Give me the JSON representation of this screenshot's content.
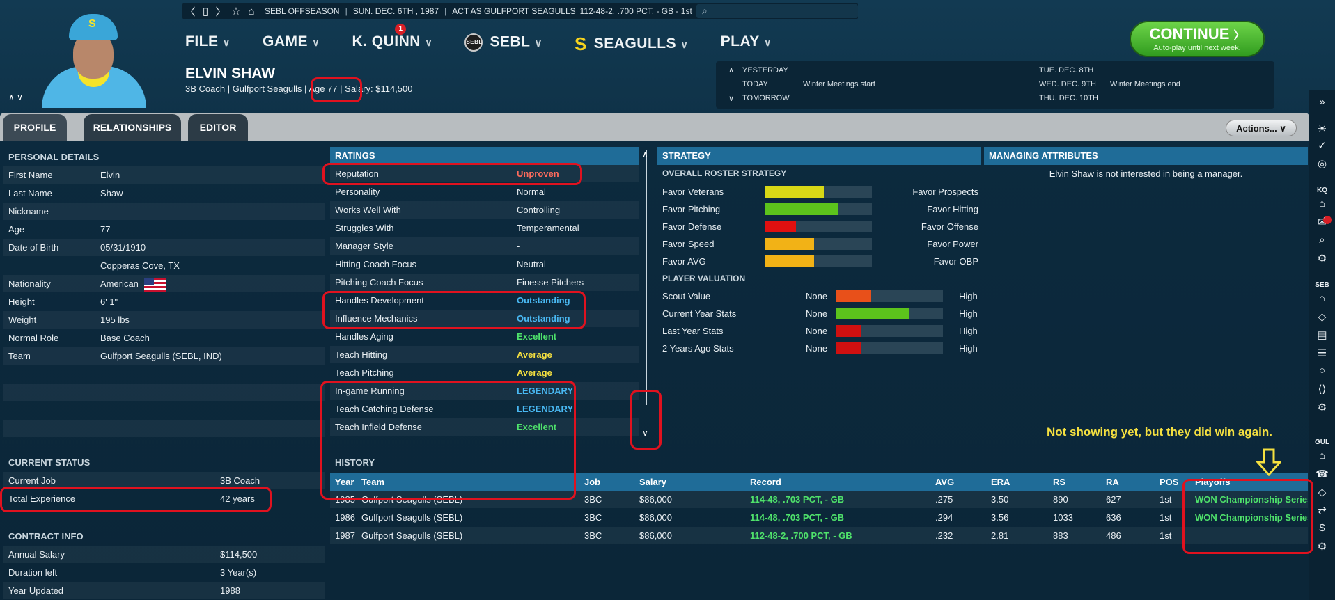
{
  "topbar": {
    "league_status": "SEBL OFFSEASON",
    "date": "SUN. DEC. 6TH , 1987",
    "act_as": "ACT AS GULFPORT SEAGULLS",
    "record": "112-48-2, .700 PCT, - GB - 1st"
  },
  "nav": {
    "items": [
      {
        "label": "FILE"
      },
      {
        "label": "GAME"
      },
      {
        "label": "K. QUINN",
        "badge": "1"
      },
      {
        "label": "SEBL",
        "logo_text": "SEBL"
      },
      {
        "label": "SEAGULLS",
        "logo_text": "S"
      },
      {
        "label": "PLAY"
      }
    ]
  },
  "continue": {
    "label": "CONTINUE",
    "sub": "Auto-play until next week.",
    "color": "#3fb02a"
  },
  "person": {
    "name": "ELVIN SHAW",
    "role": "3B Coach | Gulfport Seagulls",
    "age": "Age 77",
    "salary": "Salary: $114,500"
  },
  "schedule": {
    "yesterday": "YESTERDAY",
    "today": "TODAY",
    "tomorrow": "TOMORROW",
    "today_event": "Winter Meetings start",
    "d1": "TUE. DEC. 8TH",
    "d2": "WED. DEC. 9TH",
    "d2_event": "Winter Meetings end",
    "d3": "THU. DEC. 10TH"
  },
  "tabs": {
    "profile": "PROFILE",
    "relationships": "RELATIONSHIPS",
    "editor": "EDITOR",
    "actions": "Actions..."
  },
  "personal": {
    "title": "PERSONAL DETAILS",
    "rows": [
      {
        "k": "First Name",
        "v": "Elvin"
      },
      {
        "k": "Last Name",
        "v": "Shaw"
      },
      {
        "k": "Nickname",
        "v": ""
      },
      {
        "k": "Age",
        "v": "77"
      },
      {
        "k": "Date of Birth",
        "v": "05/31/1910"
      },
      {
        "k": "",
        "v": "Copperas Cove, TX"
      },
      {
        "k": "Nationality",
        "v": "American"
      },
      {
        "k": "Height",
        "v": "6' 1\""
      },
      {
        "k": "Weight",
        "v": "195 lbs"
      },
      {
        "k": "Normal Role",
        "v": "Base Coach"
      },
      {
        "k": "Team",
        "v": "Gulfport Seagulls (SEBL, IND)"
      }
    ]
  },
  "status": {
    "title": "CURRENT STATUS",
    "rows": [
      {
        "k": "Current Job",
        "v": "3B Coach"
      },
      {
        "k": "Total Experience",
        "v": "42 years"
      }
    ],
    "contract_title": "CONTRACT INFO",
    "contract": [
      {
        "k": "Annual Salary",
        "v": "$114,500"
      },
      {
        "k": "Duration left",
        "v": "3 Year(s)"
      },
      {
        "k": "Year Updated",
        "v": "1988"
      }
    ]
  },
  "ratings": {
    "title": "RATINGS",
    "rows": [
      {
        "k": "Reputation",
        "v": "Unproven",
        "c": "red"
      },
      {
        "k": "Personality",
        "v": "Normal",
        "c": ""
      },
      {
        "k": "Works Well With",
        "v": "Controlling",
        "c": ""
      },
      {
        "k": "Struggles With",
        "v": "Temperamental",
        "c": ""
      },
      {
        "k": "Manager Style",
        "v": "-",
        "c": ""
      },
      {
        "k": "Hitting Coach Focus",
        "v": "Neutral",
        "c": ""
      },
      {
        "k": "Pitching Coach Focus",
        "v": "Finesse Pitchers",
        "c": ""
      },
      {
        "k": "Handles Development",
        "v": "Outstanding",
        "c": "blue"
      },
      {
        "k": "Influence Mechanics",
        "v": "Outstanding",
        "c": "blue"
      },
      {
        "k": "Handles Aging",
        "v": "Excellent",
        "c": "green"
      },
      {
        "k": "Teach Hitting",
        "v": "Average",
        "c": "yellow"
      },
      {
        "k": "Teach Pitching",
        "v": "Average",
        "c": "yellow"
      },
      {
        "k": "In-game Running",
        "v": "LEGENDARY",
        "c": "blue"
      },
      {
        "k": "Teach Catching Defense",
        "v": "LEGENDARY",
        "c": "blue"
      },
      {
        "k": "Teach Infield Defense",
        "v": "Excellent",
        "c": "green"
      }
    ]
  },
  "strategy": {
    "title": "STRATEGY",
    "roster_title": "OVERALL ROSTER STRATEGY",
    "roster": [
      {
        "l": "Favor Veterans",
        "r": "Favor Prospects",
        "level": 0.55,
        "color": "#d8d816"
      },
      {
        "l": "Favor Pitching",
        "r": "Favor Hitting",
        "level": 0.68,
        "color": "#5cc31c"
      },
      {
        "l": "Favor Defense",
        "r": "Favor Offense",
        "level": 0.29,
        "color": "#e01010"
      },
      {
        "l": "Favor Speed",
        "r": "Favor Power",
        "level": 0.46,
        "color": "#f2b216"
      },
      {
        "l": "Favor AVG",
        "r": "Favor OBP",
        "level": 0.46,
        "color": "#f2b216"
      }
    ],
    "valuation_title": "PLAYER VALUATION",
    "valuation": [
      {
        "k": "Scout Value",
        "lo": "None",
        "hi": "High",
        "level": 0.33,
        "color": "#e8501a"
      },
      {
        "k": "Current Year Stats",
        "lo": "None",
        "hi": "High",
        "level": 0.68,
        "color": "#5cc31c"
      },
      {
        "k": "Last Year Stats",
        "lo": "None",
        "hi": "High",
        "level": 0.24,
        "color": "#d01010"
      },
      {
        "k": "2 Years Ago Stats",
        "lo": "None",
        "hi": "High",
        "level": 0.24,
        "color": "#d01010"
      }
    ]
  },
  "managing": {
    "title": "MANAGING ATTRIBUTES",
    "text": "Elvin Shaw is not interested in being a manager."
  },
  "history": {
    "title": "HISTORY",
    "headers": [
      "Year",
      "Team",
      "Job",
      "Salary",
      "Record",
      "AVG",
      "ERA",
      "RS",
      "RA",
      "POS",
      "Playoffs"
    ],
    "rows": [
      {
        "year": "1985",
        "team": "Gulfport Seagulls (SEBL)",
        "job": "3BC",
        "salary": "$86,000",
        "record": "114-48, .703 PCT, - GB",
        "avg": ".275",
        "era": "3.50",
        "rs": "890",
        "ra": "627",
        "pos": "1st",
        "playoffs": "WON Championship Series"
      },
      {
        "year": "1986",
        "team": "Gulfport Seagulls (SEBL)",
        "job": "3BC",
        "salary": "$86,000",
        "record": "114-48, .703 PCT, - GB",
        "avg": ".294",
        "era": "3.56",
        "rs": "1033",
        "ra": "636",
        "pos": "1st",
        "playoffs": "WON Championship Series"
      },
      {
        "year": "1987",
        "team": "Gulfport Seagulls (SEBL)",
        "job": "3BC",
        "salary": "$86,000",
        "record": "112-48-2, .700 PCT, - GB",
        "avg": ".232",
        "era": "2.81",
        "rs": "883",
        "ra": "486",
        "pos": "1st",
        "playoffs": ""
      }
    ]
  },
  "annotation": {
    "note": "Not showing yet, but they did win again."
  },
  "sidebar_labels": {
    "kq": "KQ",
    "seb": "SEB",
    "gul": "GUL",
    "mail_badge": "1"
  }
}
